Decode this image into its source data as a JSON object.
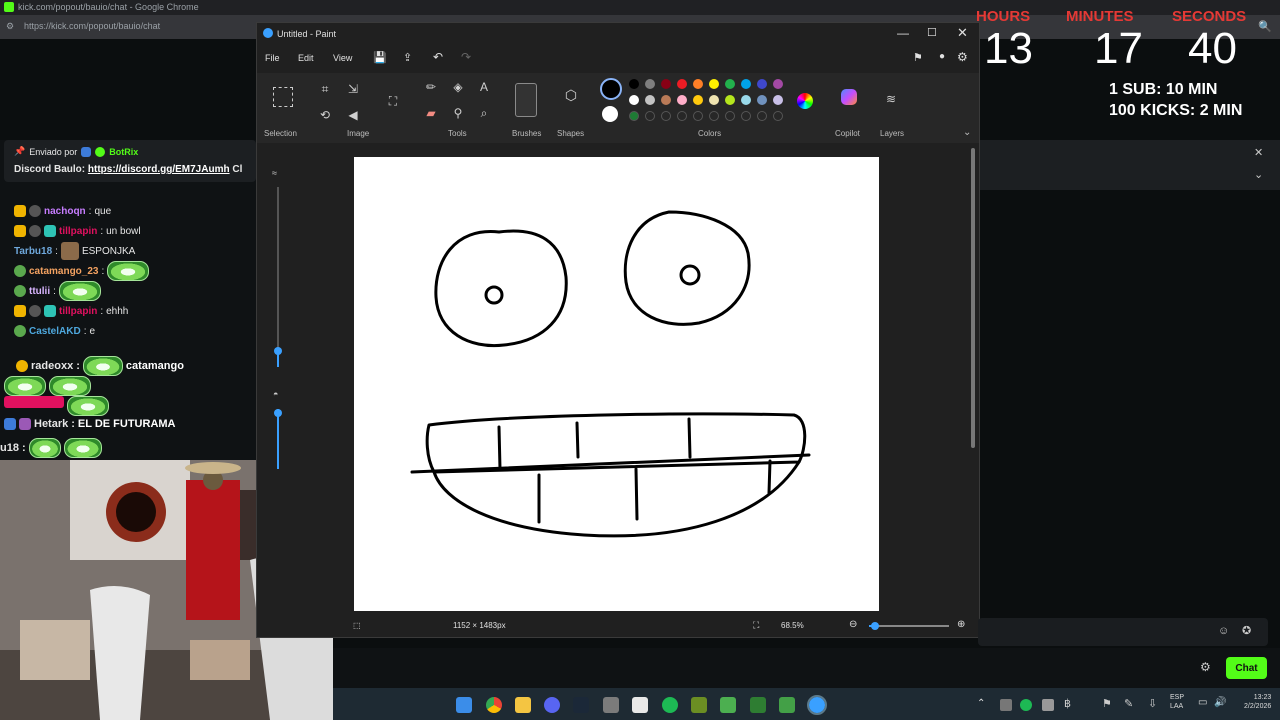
{
  "browser": {
    "window_title": "kick.com/popout/bauio/chat - Google Chrome",
    "url": "https://kick.com/popout/bauio/chat"
  },
  "pinned": {
    "sent_by_label": "Enviado por",
    "sender": "BotRix",
    "message_prefix": "Discord Baulo:",
    "link": "https://discord.gg/EM7JAumh",
    "suffix": "Cl"
  },
  "chat": {
    "messages": [
      {
        "user": "nachoqn",
        "text": "que",
        "color": "#c77dff"
      },
      {
        "user": "tillpapin",
        "text": "un bowl",
        "color": "#e0115f"
      },
      {
        "user": "Tarbu18",
        "text": "ESPONJKA",
        "color": "#6fa8dc"
      },
      {
        "user": "catamango_23",
        "text": "",
        "color": "#f4a261"
      },
      {
        "user": "ttulii",
        "text": "",
        "color": "#d8b4fe"
      },
      {
        "user": "tillpapin",
        "text": "ehhh",
        "color": "#e0115f"
      },
      {
        "user": "CastelAKD",
        "text": "e",
        "color": "#4ea8de"
      }
    ],
    "overlay_lines": [
      {
        "user": "radeoxx",
        "text": "catamango"
      },
      {
        "user": "Hetark",
        "text": "EL DE FUTURAMA"
      },
      {
        "user": "u18",
        "text": ""
      }
    ],
    "send_button": "Chat"
  },
  "timer": {
    "hours_label": "HOURS",
    "minutes_label": "MINUTES",
    "seconds_label": "SECONDS",
    "hours": "13",
    "minutes": "17",
    "seconds": "40",
    "sub_rule": "1 SUB: 10 MIN",
    "kicks_rule": "100 KICKS: 2 MIN"
  },
  "paint": {
    "title": "Untitled - Paint",
    "menu": [
      "File",
      "Edit",
      "View"
    ],
    "groups": {
      "selection": "Selection",
      "image": "Image",
      "tools": "Tools",
      "brushes": "Brushes",
      "shapes": "Shapes",
      "colors": "Colors",
      "copilot": "Copilot",
      "layers": "Layers"
    },
    "status": {
      "dimensions": "1152 × 1483px",
      "zoom": "68.5%"
    },
    "palette_row1": [
      "#000000",
      "#7f7f7f",
      "#880015",
      "#ed1c24",
      "#ff7f27",
      "#fff200",
      "#22b14c",
      "#00a2e8",
      "#3f48cc",
      "#a349a4"
    ],
    "palette_row2": [
      "#ffffff",
      "#c3c3c3",
      "#b97a57",
      "#ffaec9",
      "#ffc90e",
      "#efe4b0",
      "#b5e61d",
      "#99d9ea",
      "#7092be",
      "#c8bfe7"
    ]
  },
  "taskbar": {
    "lang_top": "ESP",
    "lang_bottom": "LAA",
    "time": "13:23",
    "date": "2/2/2026"
  }
}
